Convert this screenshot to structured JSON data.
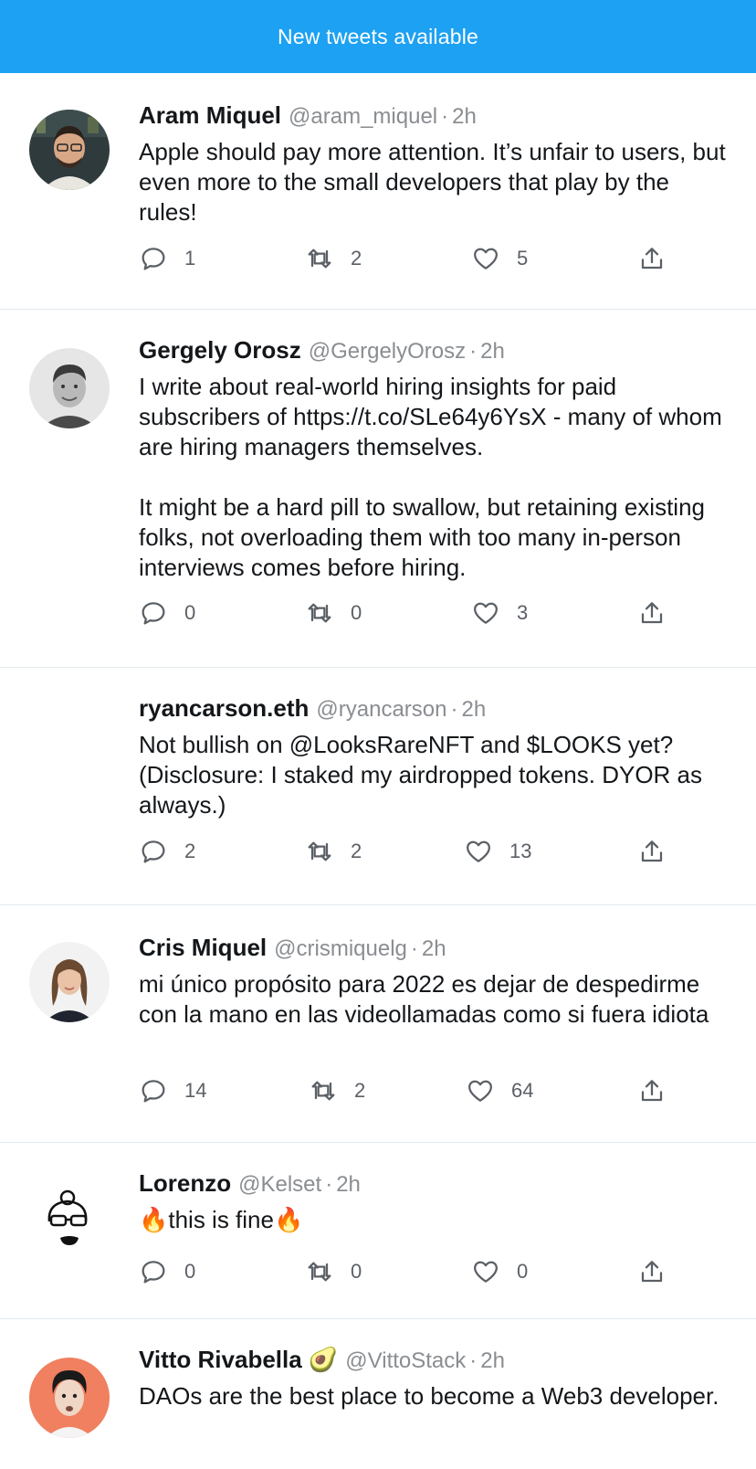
{
  "banner": {
    "label": "New tweets available"
  },
  "icons": {
    "reply": "reply-icon",
    "retweet": "retweet-icon",
    "like": "heart-icon",
    "share": "share-icon"
  },
  "tweets": [
    {
      "name": "Aram Miquel",
      "handle": "@aram_miquel",
      "time": "2h",
      "text": "Apple should pay more attention. It’s unfair to users, but even more to the small developers that play by the rules!",
      "replies": "1",
      "retweets": "2",
      "likes": "5"
    },
    {
      "name": "Gergely Orosz",
      "handle": "@GergelyOrosz",
      "time": "2h",
      "text": "I write about real-world hiring insights for paid subscribers of https://t.co/SLe64y6YsX - many of whom are hiring managers themselves.\n\nIt might be a hard pill to swallow, but retaining existing folks, not overloading them with too many in-person interviews comes before hiring.",
      "replies": "0",
      "retweets": "0",
      "likes": "3"
    },
    {
      "name": "ryancarson.eth",
      "handle": "@ryancarson",
      "time": "2h",
      "text": "Not bullish on @LooksRareNFT and $LOOKS yet? (Disclosure: I staked my airdropped tokens. DYOR as always.)",
      "replies": "2",
      "retweets": "2",
      "likes": "13"
    },
    {
      "name": "Cris Miquel",
      "handle": "@crismiquelg",
      "time": "2h",
      "text": "mi único propósito para 2022 es dejar de despedirme con la mano en las videollamadas como si fuera idiota",
      "replies": "14",
      "retweets": "2",
      "likes": "64"
    },
    {
      "name": "Lorenzo",
      "handle": "@Kelset",
      "time": "2h",
      "text": "🔥this is fine🔥",
      "replies": "0",
      "retweets": "0",
      "likes": "0"
    },
    {
      "name": "Vitto Rivabella 🥑",
      "handle": "@VittoStack",
      "time": "2h",
      "text": "DAOs are the best place to become a Web3 developer."
    }
  ]
}
